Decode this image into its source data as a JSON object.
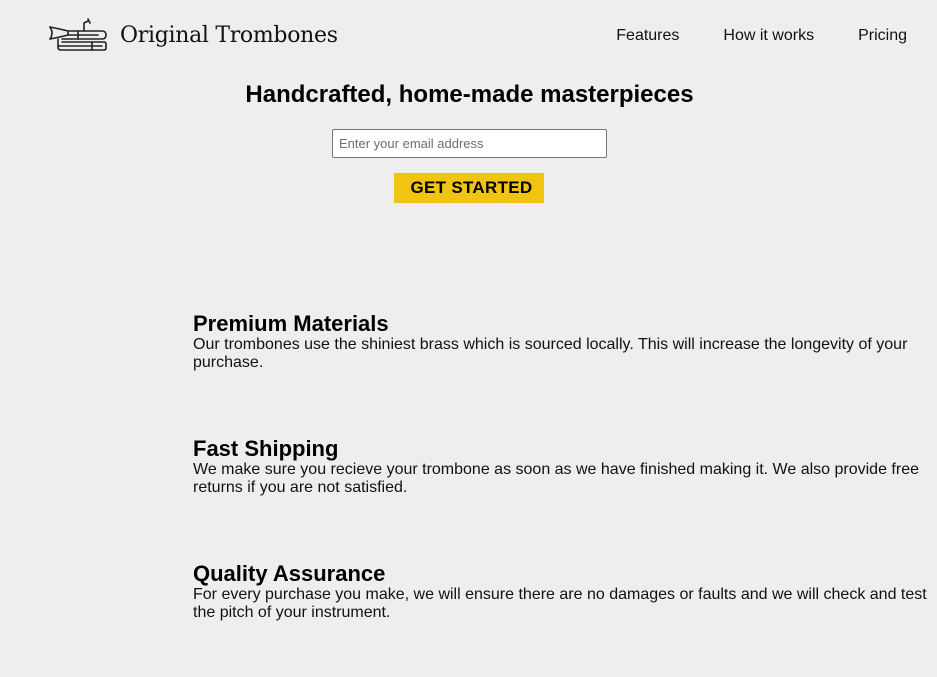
{
  "header": {
    "logo_text": "Original Trombones",
    "logo_icon": "trombone-icon",
    "nav": [
      {
        "label": "Features"
      },
      {
        "label": "How it works"
      },
      {
        "label": "Pricing"
      }
    ]
  },
  "hero": {
    "title": "Handcrafted, home-made masterpieces",
    "email_placeholder": "Enter your email address",
    "email_value": "",
    "cta_label": "GET STARTED",
    "cta_color": "#f1c40f"
  },
  "features": [
    {
      "title": "Premium Materials",
      "text": "Our trombones use the shiniest brass which is sourced locally. This will increase the longevity of your purchase."
    },
    {
      "title": "Fast Shipping",
      "text": "We make sure you recieve your trombone as soon as we have finished making it. We also provide free returns if you are not satisfied."
    },
    {
      "title": "Quality Assurance",
      "text": "For every purchase you make, we will ensure there are no damages or faults and we will check and test the pitch of your instrument."
    }
  ]
}
